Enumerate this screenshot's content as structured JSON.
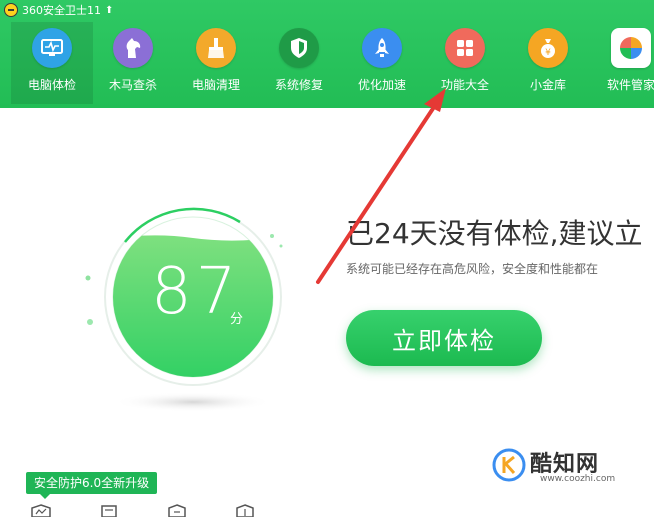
{
  "app": {
    "title": "360安全卫士11",
    "update_icon": "up-arrow-icon"
  },
  "nav": {
    "items": [
      {
        "label": "电脑体检",
        "icon": "monitor-check-icon",
        "color": "#2fa3e6",
        "active": true
      },
      {
        "label": "木马查杀",
        "icon": "horse-icon",
        "color": "#8b6fd6",
        "active": false
      },
      {
        "label": "电脑清理",
        "icon": "broom-icon",
        "color": "#f3a92b",
        "active": false
      },
      {
        "label": "系统修复",
        "icon": "shield-icon",
        "color": "#1f9b47",
        "active": false
      },
      {
        "label": "优化加速",
        "icon": "rocket-icon",
        "color": "#3b8ef0",
        "active": false
      },
      {
        "label": "功能大全",
        "icon": "grid-icon",
        "color": "#f06a5c",
        "active": false
      },
      {
        "label": "小金库",
        "icon": "money-bag-icon",
        "color": "#f5a623",
        "active": false
      },
      {
        "label": "软件管家",
        "icon": "apps-icon",
        "color": "#ffffff",
        "active": false
      }
    ]
  },
  "score": {
    "value": "87",
    "unit": "分"
  },
  "message": {
    "headline": "已24天没有体检,建议立",
    "subline": "系统可能已经存在高危风险，安全度和性能都在"
  },
  "actions": {
    "check_now": "立即体检"
  },
  "bottom": {
    "badge": "安全防护6.0全新升级"
  },
  "watermark": {
    "name": "酷知网",
    "url": "www.coozhi.com"
  },
  "colors": {
    "brand_green": "#22bd55",
    "annotation_red": "#e53935"
  }
}
